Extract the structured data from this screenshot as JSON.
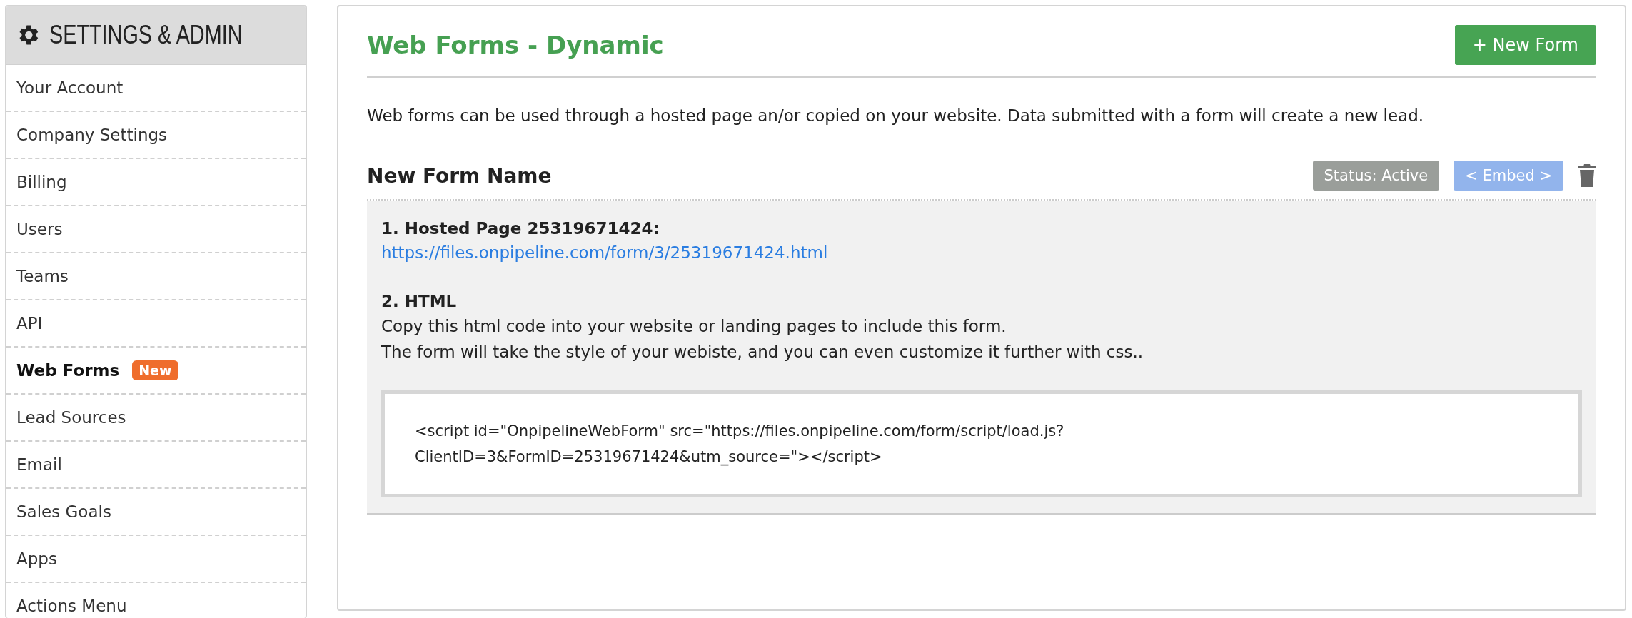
{
  "sidebar": {
    "title": "SETTINGS & ADMIN",
    "items": [
      {
        "label": "Your Account",
        "selected": false
      },
      {
        "label": "Company Settings",
        "selected": false
      },
      {
        "label": "Billing",
        "selected": false
      },
      {
        "label": "Users",
        "selected": false
      },
      {
        "label": "Teams",
        "selected": false
      },
      {
        "label": "API",
        "selected": false
      },
      {
        "label": "Web Forms",
        "selected": true,
        "badge": "New"
      },
      {
        "label": "Lead Sources",
        "selected": false
      },
      {
        "label": "Email",
        "selected": false
      },
      {
        "label": "Sales Goals",
        "selected": false
      },
      {
        "label": "Apps",
        "selected": false
      },
      {
        "label": "Actions Menu",
        "selected": false
      }
    ]
  },
  "main": {
    "title": "Web Forms - Dynamic",
    "new_button": "+ New Form",
    "intro": "Web forms can be used through a hosted page an/or copied on your website. Data submitted with a form will create a new lead.",
    "form": {
      "name": "New Form Name",
      "status": "Status: Active",
      "embed_button": "< Embed >",
      "hosted_heading": "1. Hosted Page 25319671424:",
      "hosted_link": "https://files.onpipeline.com/form/3/25319671424.html",
      "html_heading": "2. HTML",
      "html_lines": [
        "Copy this html code into your website or landing pages to include this form.",
        "The form will take the style of your webiste, and you can even customize it further with css.."
      ],
      "code_lines": [
        "<script id=\"OnpipelineWebForm\" src=\"https://files.onpipeline.com/form/script/load.js?",
        "ClientID=3&FormID=25319671424&utm_source=\"></script>"
      ]
    }
  }
}
